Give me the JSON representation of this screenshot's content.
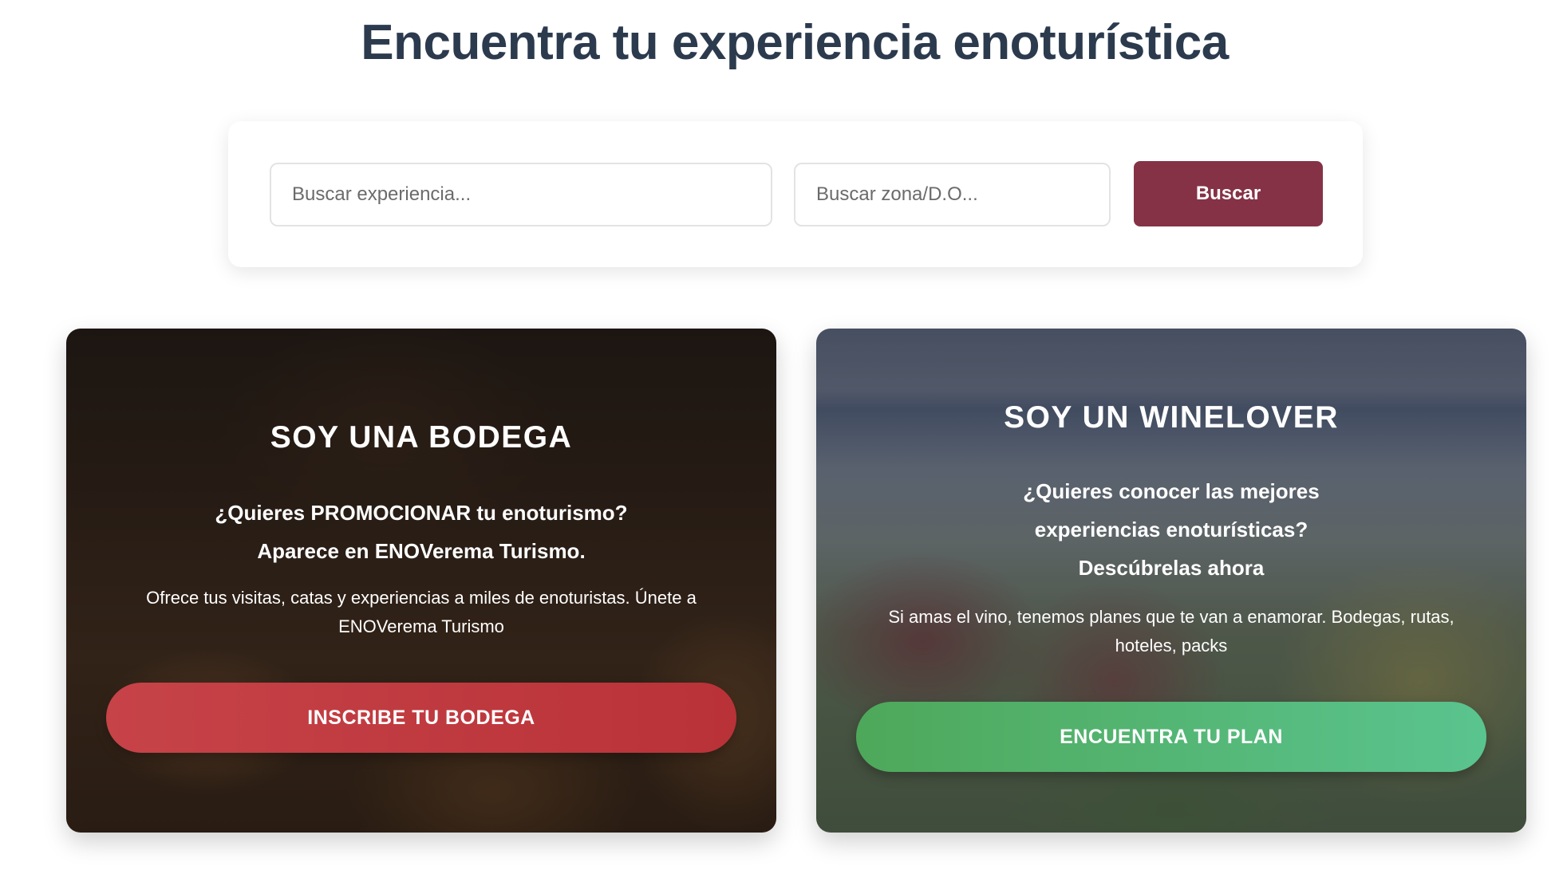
{
  "page": {
    "title": "Encuentra tu experiencia enoturística"
  },
  "search": {
    "experience_placeholder": "Buscar experiencia...",
    "zone_placeholder": "Buscar zona/D.O...",
    "button_label": "Buscar"
  },
  "cards": {
    "bodega": {
      "title": "SOY UNA BODEGA",
      "subtitle_line1": "¿Quieres PROMOCIONAR tu enoturismo?",
      "subtitle_line2": "Aparece en ENOVerema Turismo.",
      "text": "Ofrece tus visitas, catas y experiencias a miles de enoturistas. Únete a ENOVerema Turismo",
      "button_label": "INSCRIBE TU BODEGA"
    },
    "winelover": {
      "title": "SOY UN WINELOVER",
      "subtitle_line1": "¿Quieres conocer las mejores",
      "subtitle_line2": "experiencias enoturísticas?",
      "subtitle_line3": "Descúbrelas ahora",
      "text": "Si amas el vino, tenemos planes que te van a enamorar. Bodegas, rutas, hoteles, packs",
      "button_label": "ENCUENTRA TU PLAN"
    }
  },
  "colors": {
    "title": "#2c3a4e",
    "search_button": "#853246",
    "bodega_button": "#c64348",
    "winelover_button": "#4ea85a"
  }
}
